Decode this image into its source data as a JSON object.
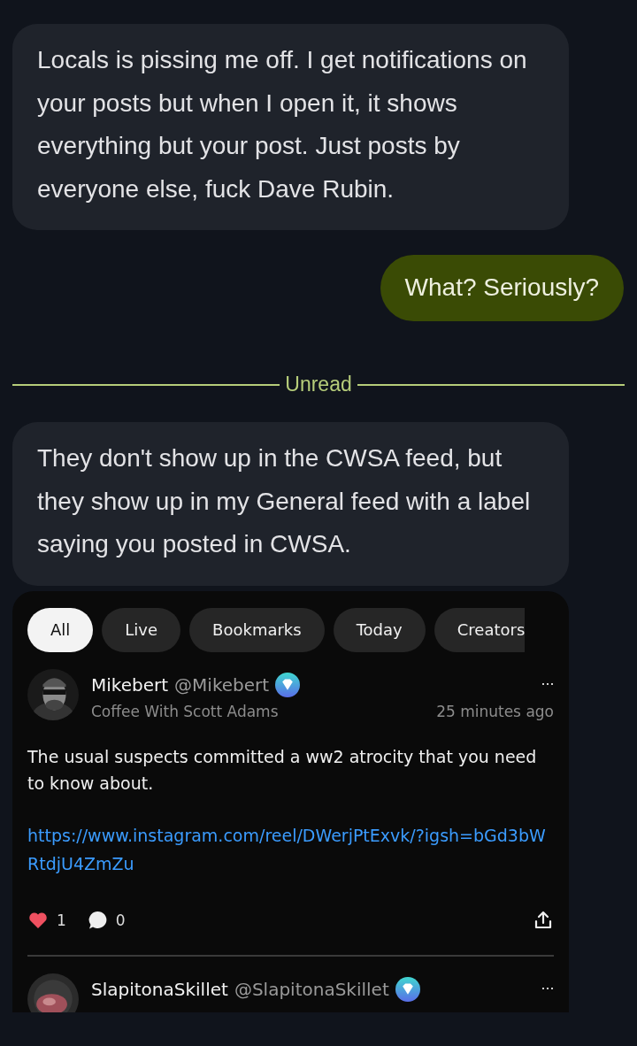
{
  "messages": [
    {
      "kind": "incoming",
      "text": "Locals is pissing me off. I get notifications on your posts but when I open it, it shows everything but your post. Just posts by everyone else, fuck Dave Rubin."
    },
    {
      "kind": "outgoing",
      "text": "What? Seriously?"
    },
    {
      "kind": "divider",
      "text": "Unread"
    },
    {
      "kind": "incoming",
      "text": "They don't show up in the CWSA feed, but they show up in my General feed with a label saying you posted in CWSA."
    },
    {
      "kind": "attachment",
      "tabs": [
        {
          "label": "All",
          "selected": true
        },
        {
          "label": "Live",
          "selected": false
        },
        {
          "label": "Bookmarks",
          "selected": false
        },
        {
          "label": "Today",
          "selected": false
        },
        {
          "label": "Creators",
          "selected": false
        }
      ],
      "posts": [
        {
          "name": "Mikebert",
          "handle": "@Mikebert",
          "community": "Coffee With Scott Adams",
          "time": "25 minutes ago",
          "more": "···",
          "body": "The usual suspects committed a ww2 atrocity that you need to know about.",
          "link": "https://www.instagram.com/reel/DWerjPtExvk/?igsh=bGd3bWRtdjU4ZmZu",
          "likes": "1",
          "comments": "0"
        },
        {
          "name": "SlapitonaSkillet",
          "handle": "@SlapitonaSkillet",
          "more": "···"
        }
      ]
    }
  ]
}
